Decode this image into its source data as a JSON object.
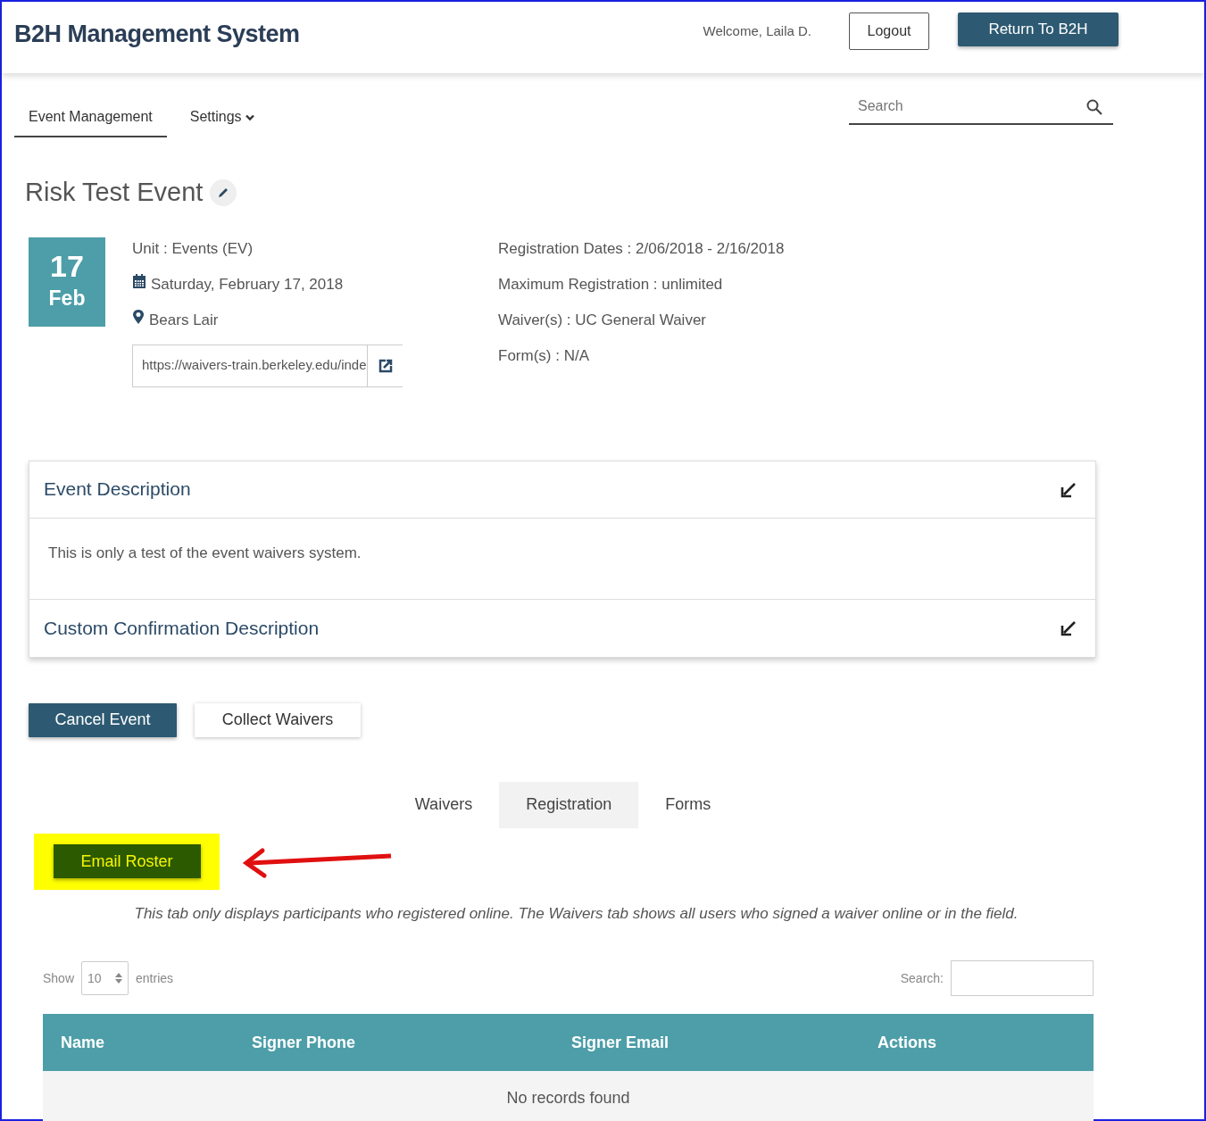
{
  "header": {
    "title": "B2H Management System",
    "welcome": "Welcome, Laila D.",
    "buttons": [
      {
        "label": "Logout",
        "kind": "outline"
      },
      {
        "label": "Return To B2H",
        "kind": "primary"
      }
    ]
  },
  "nav": {
    "items": [
      {
        "label": "Event Management",
        "selected": true,
        "kind": "link"
      },
      {
        "label": "Settings",
        "selected": false,
        "kind": "dropdown"
      }
    ],
    "search": {
      "placeholder": "Search"
    }
  },
  "event": {
    "title": "Risk Test Event",
    "date": {
      "day": "17",
      "month": "Feb"
    },
    "details": [
      {
        "kind": "text",
        "text": "Unit : Events (EV)"
      },
      {
        "kind": "calendar",
        "text": "Saturday, February 17, 2018"
      },
      {
        "kind": "location",
        "text": "Bears Lair"
      }
    ],
    "url": "https://waivers-train.berkeley.edu/inde",
    "info": [
      "Registration Dates : 2/06/2018 - 2/16/2018",
      "Maximum Registration : unlimited",
      "Waiver(s) : UC General Waiver",
      "Form(s) : N/A"
    ]
  },
  "panels": [
    {
      "title": "Event Description",
      "body": "This is only a test of the event waivers system."
    },
    {
      "title": "Custom Confirmation Description"
    }
  ],
  "actions": [
    {
      "label": "Cancel Event",
      "kind": "primary"
    },
    {
      "label": "Collect Waivers",
      "kind": "light"
    }
  ],
  "tabs": [
    {
      "label": "Waivers",
      "selected": false
    },
    {
      "label": "Registration",
      "selected": true
    },
    {
      "label": "Forms",
      "selected": false
    }
  ],
  "email_button": {
    "label": "Email Roster"
  },
  "note": "This tab only displays participants who registered online. The Waivers tab shows all users who signed a waiver online or in the field.",
  "table": {
    "show_label": "Show",
    "page_size": "10",
    "entries_label": "entries",
    "search_label": "Search:",
    "columns": [
      "Name",
      "Signer Phone",
      "Signer Email",
      "Actions"
    ],
    "empty_message": "No records found"
  }
}
